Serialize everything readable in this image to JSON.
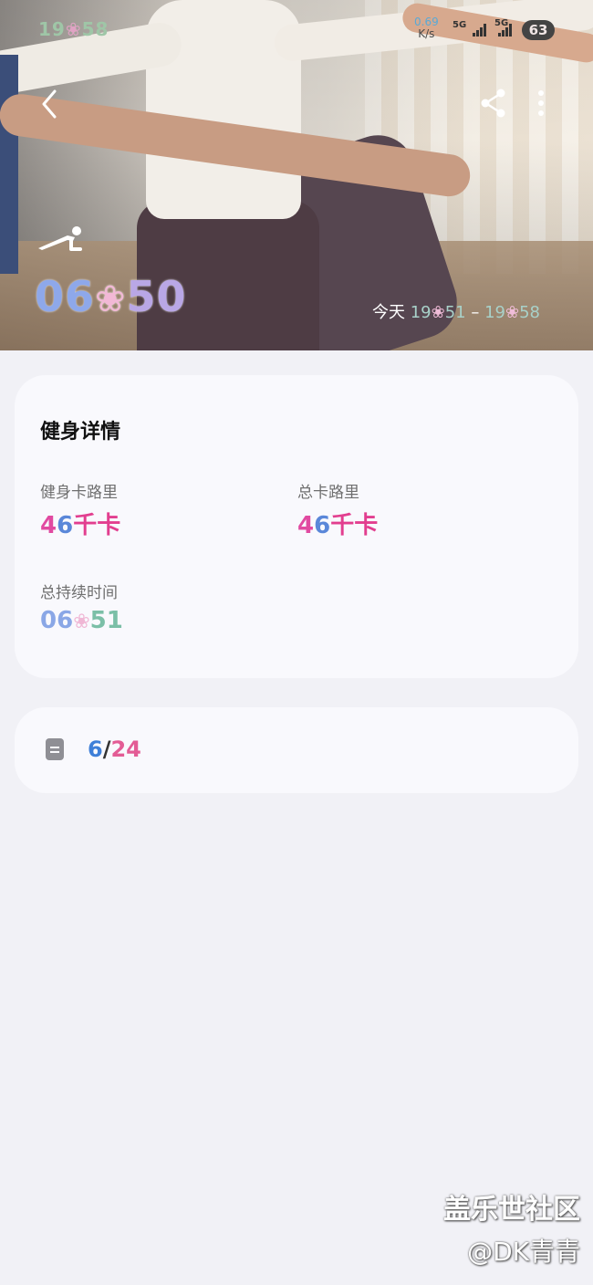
{
  "status_bar": {
    "time_hour": "19",
    "time_min": "58",
    "net_speed_value": "0.69",
    "net_speed_unit": "K/s",
    "sim1": "5G",
    "sim2": "5G",
    "battery": "63"
  },
  "hero": {
    "duration_a": "06",
    "duration_b": "50",
    "today_label": "今天",
    "start_hour": "19",
    "start_min": "51",
    "separator": "–",
    "end_hour": "19",
    "end_min": "58"
  },
  "details": {
    "title": "健身详情",
    "workout_cal_label": "健身卡路里",
    "workout_cal_num_a": "4",
    "workout_cal_num_b": "6",
    "workout_cal_unit": "千卡",
    "total_cal_label": "总卡路里",
    "total_cal_num_a": "4",
    "total_cal_num_b": "6",
    "total_cal_unit": "千卡",
    "total_duration_label": "总持续时间",
    "total_duration_a": "06",
    "total_duration_b": "51"
  },
  "note": {
    "month": "6",
    "slash": "/",
    "day": "24"
  },
  "watermark": {
    "line1": "盖乐世社区",
    "line2": "@DK青青"
  },
  "colors": {
    "background": "#f1f1f6",
    "card": "#f9f9fd",
    "kcal_accent": "#e23e8f"
  },
  "icons": [
    "back-icon",
    "share-icon",
    "more-icon",
    "plank-exercise-icon",
    "note-icon",
    "flower-decoration-icon"
  ]
}
